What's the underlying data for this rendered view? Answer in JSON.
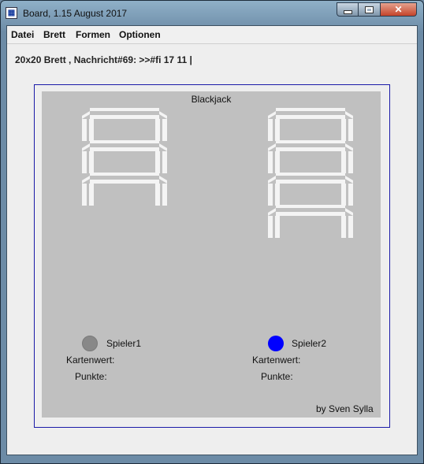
{
  "window": {
    "title": "Board, 1.15 August 2017",
    "icon": "board-app-icon"
  },
  "menu": [
    "Datei",
    "Brett",
    "Formen",
    "Optionen"
  ],
  "status_line": "20x20 Brett , Nachricht#69: >>#fi 17 11 |",
  "board": {
    "title": "Blackjack",
    "credit": "by Sven Sylla",
    "players": [
      {
        "name": "Spieler1",
        "color": "#888888",
        "kartenwert_label": "Kartenwert:",
        "punkte_label": "Punkte:",
        "card_count": 3
      },
      {
        "name": "Spieler2",
        "color": "#0000ff",
        "kartenwert_label": "Kartenwert:",
        "punkte_label": "Punkte:",
        "card_count": 4
      }
    ]
  },
  "colors": {
    "board_bg": "#c0c0c0",
    "board_border": "#1a1aa8"
  }
}
